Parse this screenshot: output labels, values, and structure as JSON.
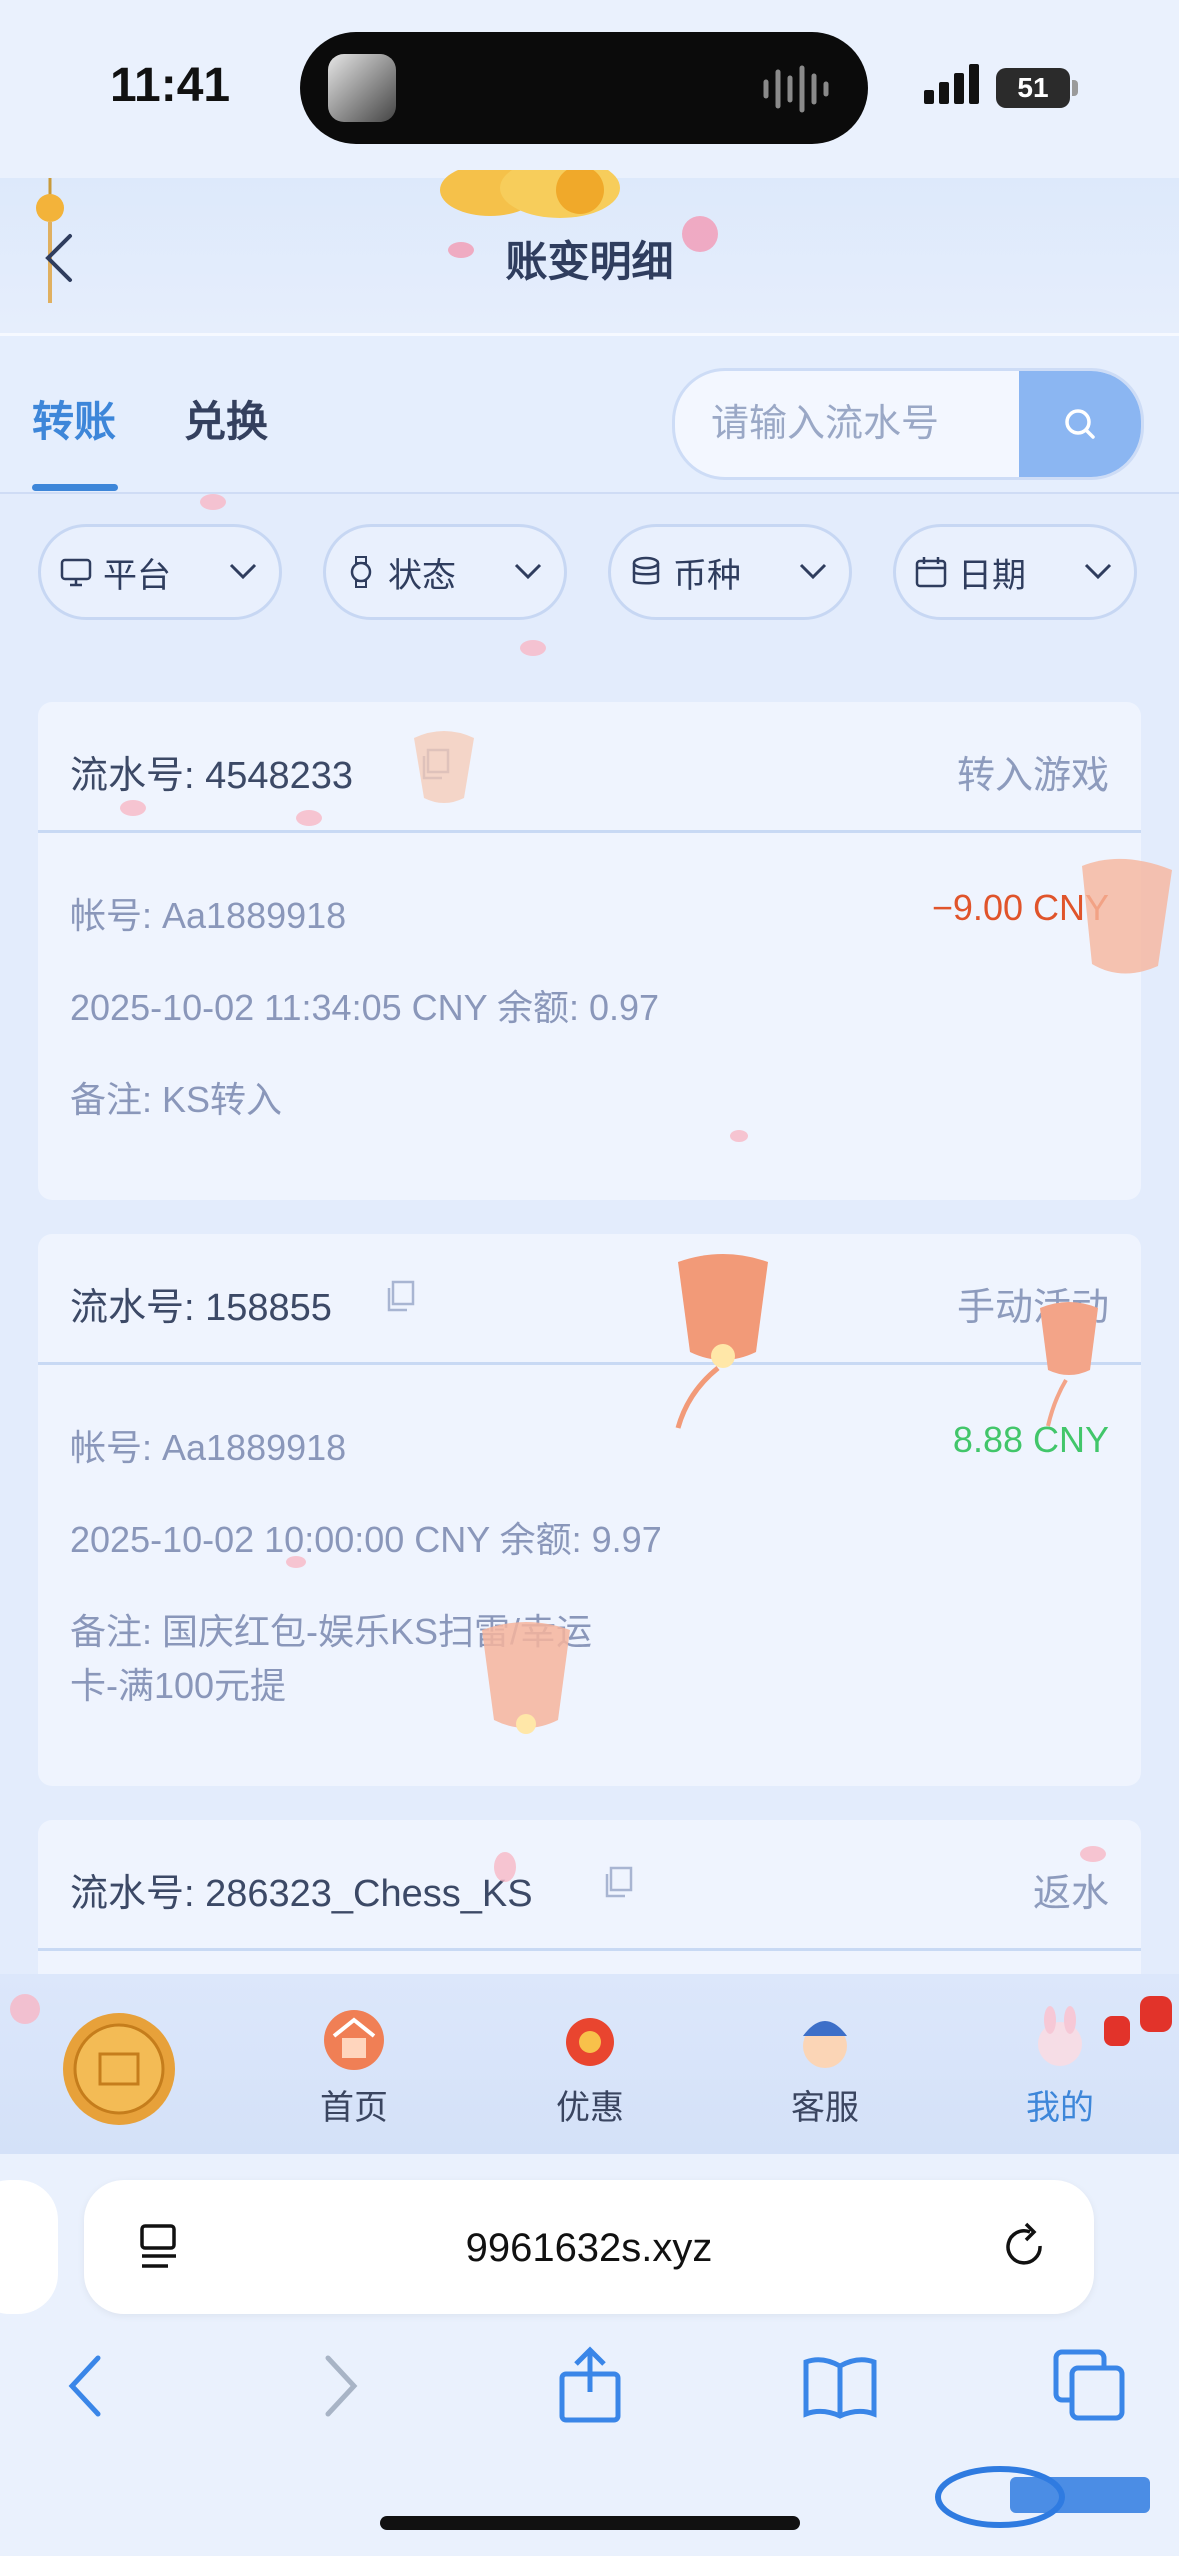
{
  "status_bar": {
    "time": "11:41",
    "battery": "51"
  },
  "header": {
    "title": "账变明细"
  },
  "tabs": [
    {
      "label": "转账",
      "active": true
    },
    {
      "label": "兑换",
      "active": false
    }
  ],
  "search": {
    "placeholder": "请输入流水号"
  },
  "filters": [
    {
      "label": "平台",
      "icon": "monitor-icon"
    },
    {
      "label": "状态",
      "icon": "watch-icon"
    },
    {
      "label": "币种",
      "icon": "coins-icon"
    },
    {
      "label": "日期",
      "icon": "calendar-icon"
    }
  ],
  "records": [
    {
      "serial": "流水号: 4548233",
      "type": "转入游戏",
      "account": "帐号: Aa1889918",
      "amount": "−9.00 CNY",
      "time_balance": "2025-10-02 11:34:05 CNY 余额: 0.97",
      "note": "备注: KS转入"
    },
    {
      "serial": "流水号: 158855",
      "type": "手动活动",
      "account": "帐号: Aa1889918",
      "amount": "8.88 CNY",
      "time_balance": "2025-10-02 10:00:00 CNY 余额: 9.97",
      "note_line1": "备注: 国庆红包-娱乐KS扫雷/幸运",
      "note_line2": "卡-满100元提"
    },
    {
      "serial": "流水号: 286323_Chess_KS",
      "type": "返水"
    }
  ],
  "tabbar": [
    {
      "label": "首页",
      "icon": "home-icon"
    },
    {
      "label": "优惠",
      "icon": "promo-icon"
    },
    {
      "label": "客服",
      "icon": "support-icon"
    },
    {
      "label": "我的",
      "icon": "profile-icon",
      "active": true
    }
  ],
  "browser": {
    "url": "9961632s.xyz"
  },
  "colors": {
    "accent": "#3d86d9",
    "negative": "#e0542b",
    "positive": "#42c66a"
  }
}
